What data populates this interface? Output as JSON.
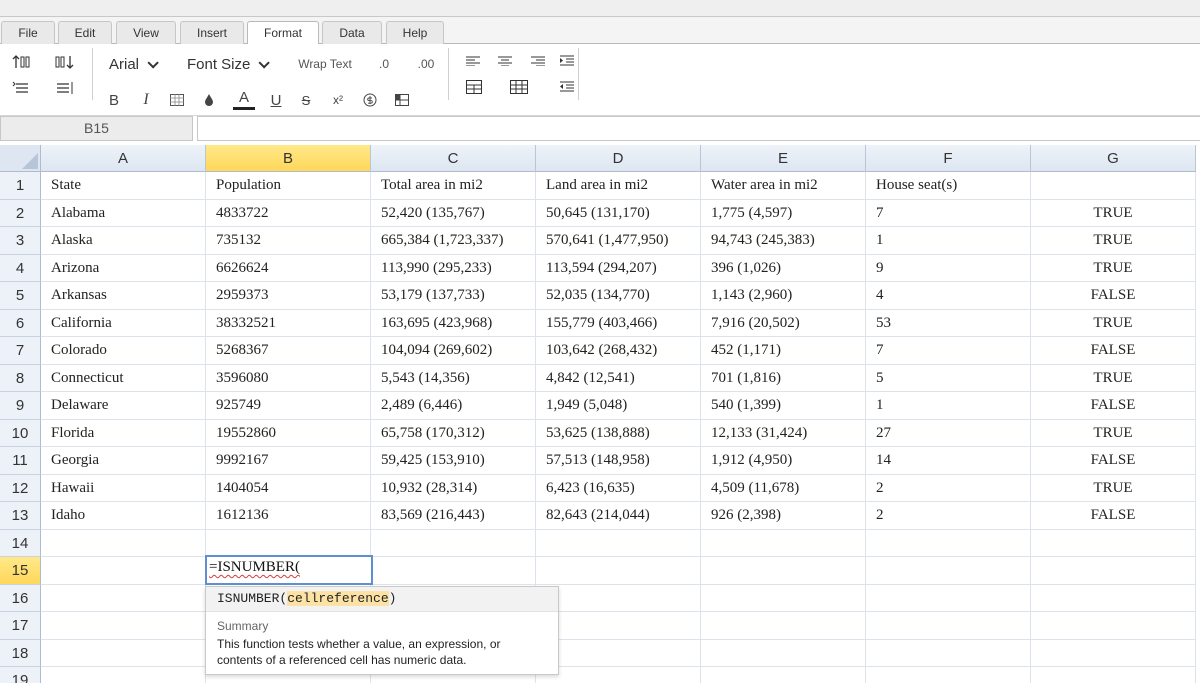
{
  "menu": {
    "tabs": [
      "File",
      "Edit",
      "View",
      "Insert",
      "Format",
      "Data",
      "Help"
    ],
    "active_tab": "Format"
  },
  "toolbar": {
    "font_name": "Arial",
    "font_size": "Font Size",
    "wrap_text": "Wrap Text",
    "decimal_decrease": ".0",
    "decimal_increase": ".00",
    "bold": "B",
    "italic": "I",
    "font_color_letter": "A",
    "underline": "U",
    "strike": "S",
    "superscript": "x²"
  },
  "name_box": "B15",
  "formula_bar": "",
  "columns": [
    "A",
    "B",
    "C",
    "D",
    "E",
    "F",
    "G"
  ],
  "selected_column": "B",
  "rows": [
    "1",
    "2",
    "3",
    "4",
    "5",
    "6",
    "7",
    "8",
    "9",
    "10",
    "11",
    "12",
    "13",
    "14",
    "15",
    "16",
    "17",
    "18",
    "19"
  ],
  "selected_row": "15",
  "cells": [
    [
      "State",
      "Population",
      "Total area in mi2",
      "Land area in mi2",
      "Water area in mi2",
      "House seat(s)",
      ""
    ],
    [
      "Alabama",
      "4833722",
      "52,420 (135,767)",
      "50,645 (131,170)",
      "1,775 (4,597)",
      "7",
      "TRUE"
    ],
    [
      "Alaska",
      "735132",
      "665,384 (1,723,337)",
      "570,641 (1,477,950)",
      "94,743 (245,383)",
      "1",
      "TRUE"
    ],
    [
      "Arizona",
      "6626624",
      "113,990 (295,233)",
      "113,594 (294,207)",
      "396 (1,026)",
      "9",
      "TRUE"
    ],
    [
      "Arkansas",
      "2959373",
      "53,179 (137,733)",
      "52,035 (134,770)",
      "1,143 (2,960)",
      "4",
      "FALSE"
    ],
    [
      "California",
      "38332521",
      "163,695 (423,968)",
      "155,779 (403,466)",
      "7,916 (20,502)",
      "53",
      "TRUE"
    ],
    [
      "Colorado",
      "5268367",
      "104,094 (269,602)",
      "103,642 (268,432)",
      "452 (1,171)",
      "7",
      "FALSE"
    ],
    [
      "Connecticut",
      "3596080",
      "5,543 (14,356)",
      "4,842 (12,541)",
      "701 (1,816)",
      "5",
      "TRUE"
    ],
    [
      "Delaware",
      "925749",
      "2,489 (6,446)",
      "1,949 (5,048)",
      "540 (1,399)",
      "1",
      "FALSE"
    ],
    [
      "Florida",
      "19552860",
      "65,758 (170,312)",
      "53,625 (138,888)",
      "12,133 (31,424)",
      "27",
      "TRUE"
    ],
    [
      "Georgia",
      "9992167",
      "59,425 (153,910)",
      "57,513 (148,958)",
      "1,912 (4,950)",
      "14",
      "FALSE"
    ],
    [
      "Hawaii",
      "1404054",
      "10,932 (28,314)",
      "6,423 (16,635)",
      "4,509 (11,678)",
      "2",
      "TRUE"
    ],
    [
      "Idaho",
      "1612136",
      "83,569 (216,443)",
      "82,643 (214,044)",
      "926 (2,398)",
      "2",
      "FALSE"
    ]
  ],
  "editor": {
    "value": "=ISNUMBER("
  },
  "autocomplete": {
    "function": "ISNUMBER(",
    "param": "cellreference",
    "close": ")",
    "summary_label": "Summary",
    "summary_text": "This function tests whether a value, an expression, or contents of a referenced cell has numeric data."
  }
}
